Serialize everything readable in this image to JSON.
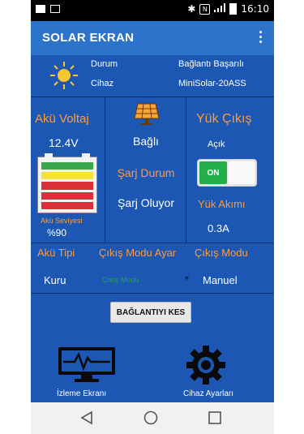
{
  "status_bar": {
    "time": "16:10",
    "icons": [
      "image-icon",
      "bluetooth-icon",
      "nfc-icon",
      "signal-icon",
      "battery-icon"
    ]
  },
  "app_bar": {
    "title": "SOLAR EKRAN",
    "menu_icon": "more-vert-icon"
  },
  "info": {
    "durum_label": "Durum",
    "durum_value": "Bağlantı Başarılı",
    "cihaz_label": "Cihaz",
    "cihaz_value": "MiniSolar-20ASS",
    "icon": "sun-icon"
  },
  "battery": {
    "title": "Akü Voltaj",
    "voltage": "12.4V",
    "level_label": "Akü Seviyesi",
    "level_value": "%90",
    "level_fraction": 0.9,
    "bar_colors": [
      "#3aa84a",
      "#f2e23a",
      "#d9303a",
      "#d9303a",
      "#d9303a"
    ]
  },
  "panel": {
    "icon": "solar-panel-icon",
    "connection": "Bağlı",
    "charge_title": "Şarj Durum",
    "charge_value": "Şarj Oluyor"
  },
  "load": {
    "title": "Yük Çıkış",
    "state_label": "Açık",
    "toggle_label": "ON",
    "toggle_on": true,
    "current_title": "Yük Akımı",
    "current_value": "0.3A"
  },
  "battery_type": {
    "title": "Akü Tipi",
    "value": "Kuru"
  },
  "output_mode_set": {
    "title": "Çıkış Modu Ayar",
    "placeholder": "Çıkış Modu"
  },
  "output_mode": {
    "title": "Çıkış Modu",
    "value": "Manuel"
  },
  "disconnect_button": "BAĞLANTIYI KES",
  "bottom": {
    "monitor_label": "İzleme Ekranı",
    "monitor_icon": "monitor-pulse-icon",
    "settings_label": "Cihaz Ayarları",
    "settings_icon": "gear-icon"
  },
  "nav": [
    "back-icon",
    "home-icon",
    "recents-icon"
  ],
  "colors": {
    "app_bar": "#2d73c9",
    "background": "#1c58b3",
    "accent_orange": "#ff9a3c",
    "toggle_green": "#23b04a"
  }
}
